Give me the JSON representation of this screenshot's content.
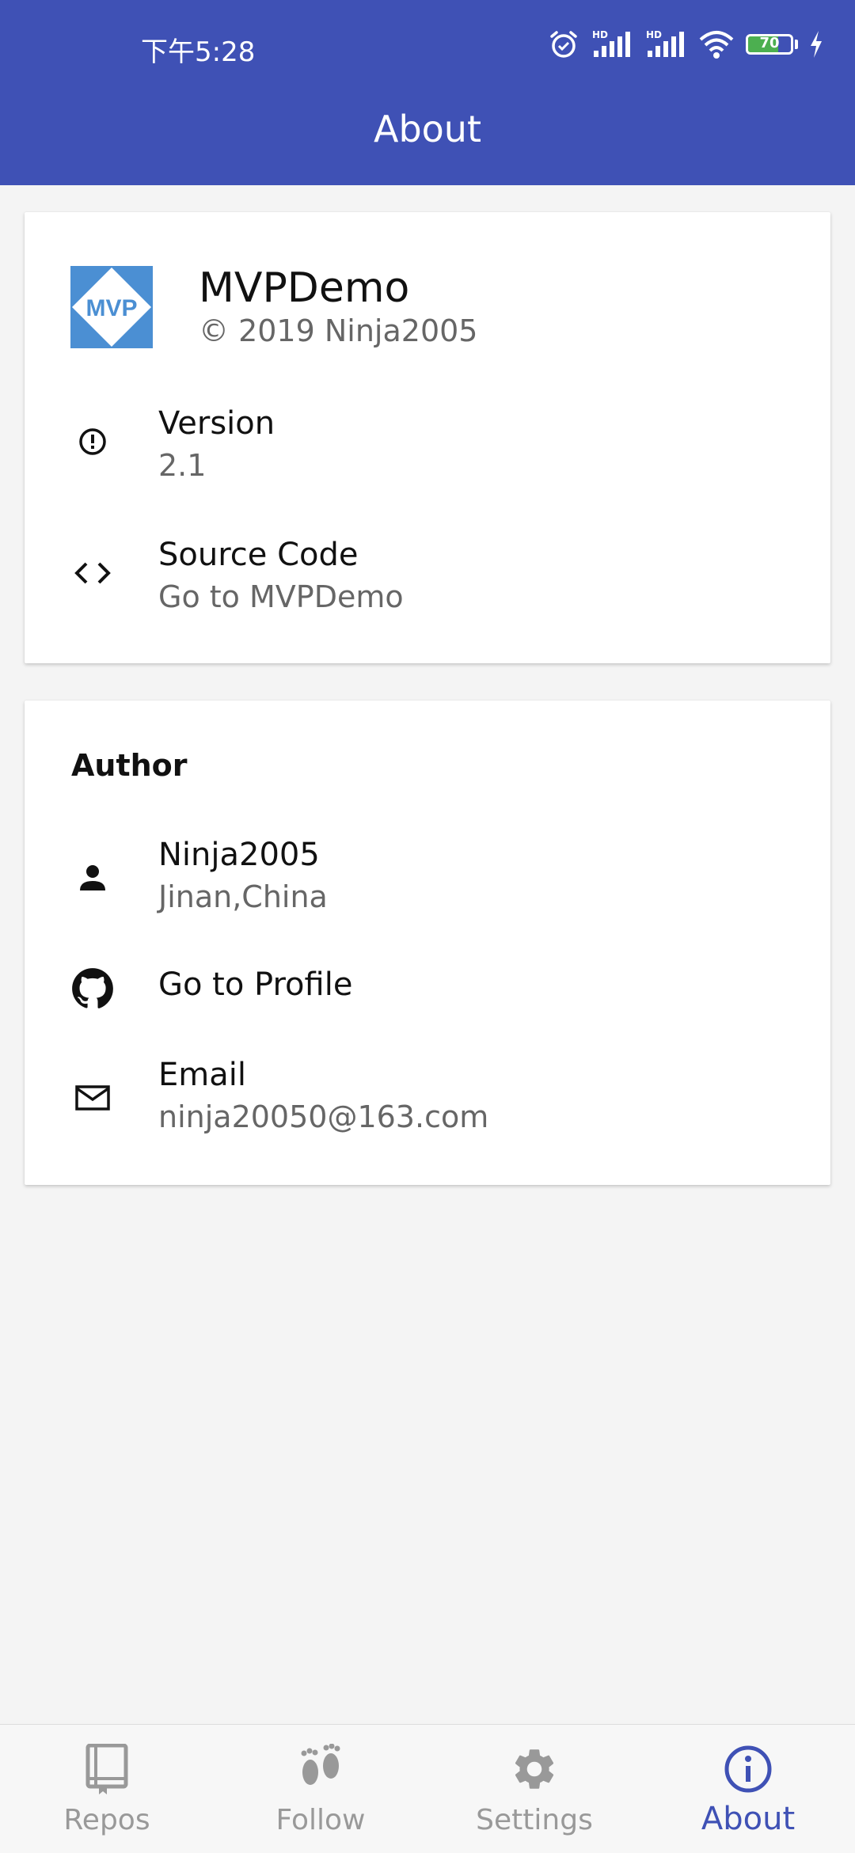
{
  "status_bar": {
    "time": "下午5:28",
    "battery_level": "70",
    "battery_fraction": 0.7,
    "icons": [
      "alarm-icon",
      "signal-hd-icon",
      "signal-hd-icon",
      "wifi-icon",
      "battery-icon",
      "charging-icon"
    ]
  },
  "app_bar": {
    "title": "About"
  },
  "app_card": {
    "logo_text": "MVP",
    "app_name": "MVPDemo",
    "copyright": "© 2019 Ninja2005",
    "version": {
      "title": "Version",
      "value": "2.1",
      "icon": "info-icon"
    },
    "source": {
      "title": "Source Code",
      "value": "Go to MVPDemo",
      "icon": "code-icon"
    }
  },
  "author_card": {
    "heading": "Author",
    "name": {
      "title": "Ninja2005",
      "value": "Jinan,China",
      "icon": "person-icon"
    },
    "profile": {
      "title": "Go to Profile",
      "icon": "github-icon"
    },
    "email": {
      "title": "Email",
      "value": "ninja20050@163.com",
      "icon": "mail-icon"
    }
  },
  "bottom_nav": {
    "items": [
      {
        "label": "Repos",
        "icon": "book-icon",
        "active": false
      },
      {
        "label": "Follow",
        "icon": "footprints-icon",
        "active": false
      },
      {
        "label": "Settings",
        "icon": "gear-icon",
        "active": false
      },
      {
        "label": "About",
        "icon": "info-circle-icon",
        "active": true
      }
    ]
  },
  "colors": {
    "primary": "#3f51b5",
    "background": "#f4f4f4",
    "logo_blue": "#4b8fd3",
    "inactive_nav": "#999999"
  }
}
